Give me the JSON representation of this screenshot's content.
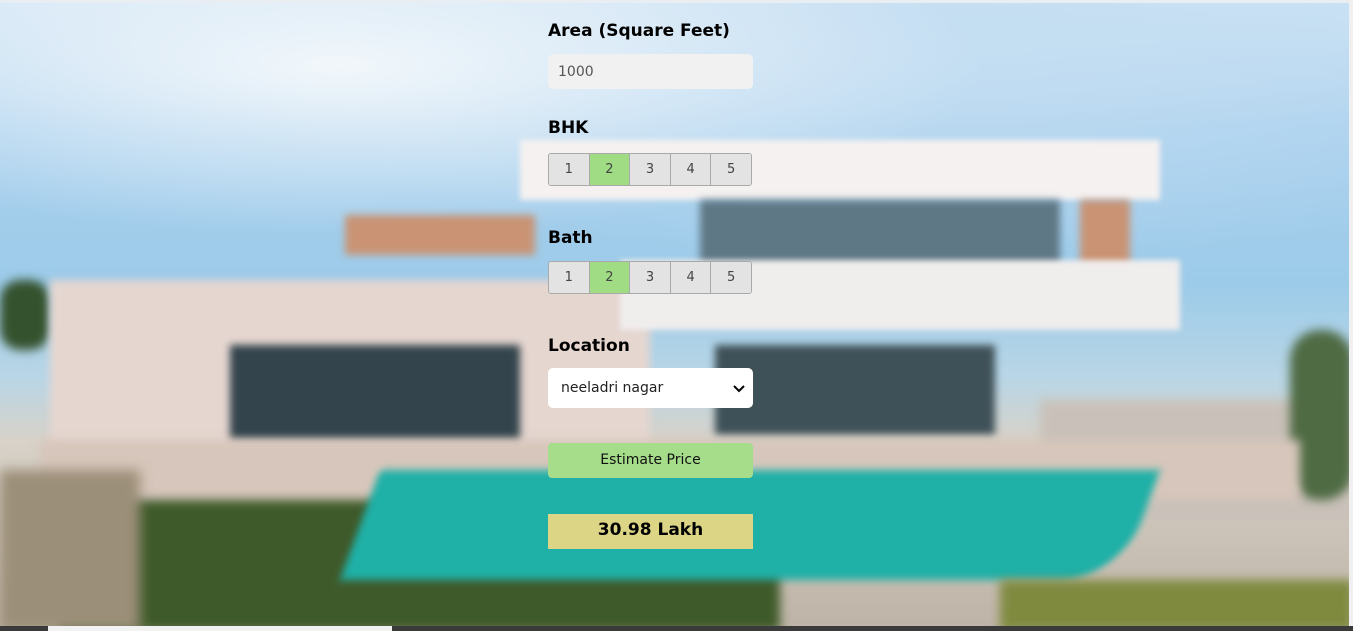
{
  "form": {
    "area_label": "Area (Square Feet)",
    "area_value": "1000",
    "bhk_label": "BHK",
    "bhk_options": [
      "1",
      "2",
      "3",
      "4",
      "5"
    ],
    "bhk_selected": "2",
    "bath_label": "Bath",
    "bath_options": [
      "1",
      "2",
      "3",
      "4",
      "5"
    ],
    "bath_selected": "2",
    "location_label": "Location",
    "location_value": "neeladri nagar",
    "estimate_button": "Estimate Price",
    "result": "30.98 Lakh"
  },
  "colors": {
    "selected_segment": "#a0dc84",
    "button_bg": "#a5dd8a",
    "result_bg": "#dcd586"
  },
  "icons": {
    "select_arrow": "chevron-down-icon"
  }
}
